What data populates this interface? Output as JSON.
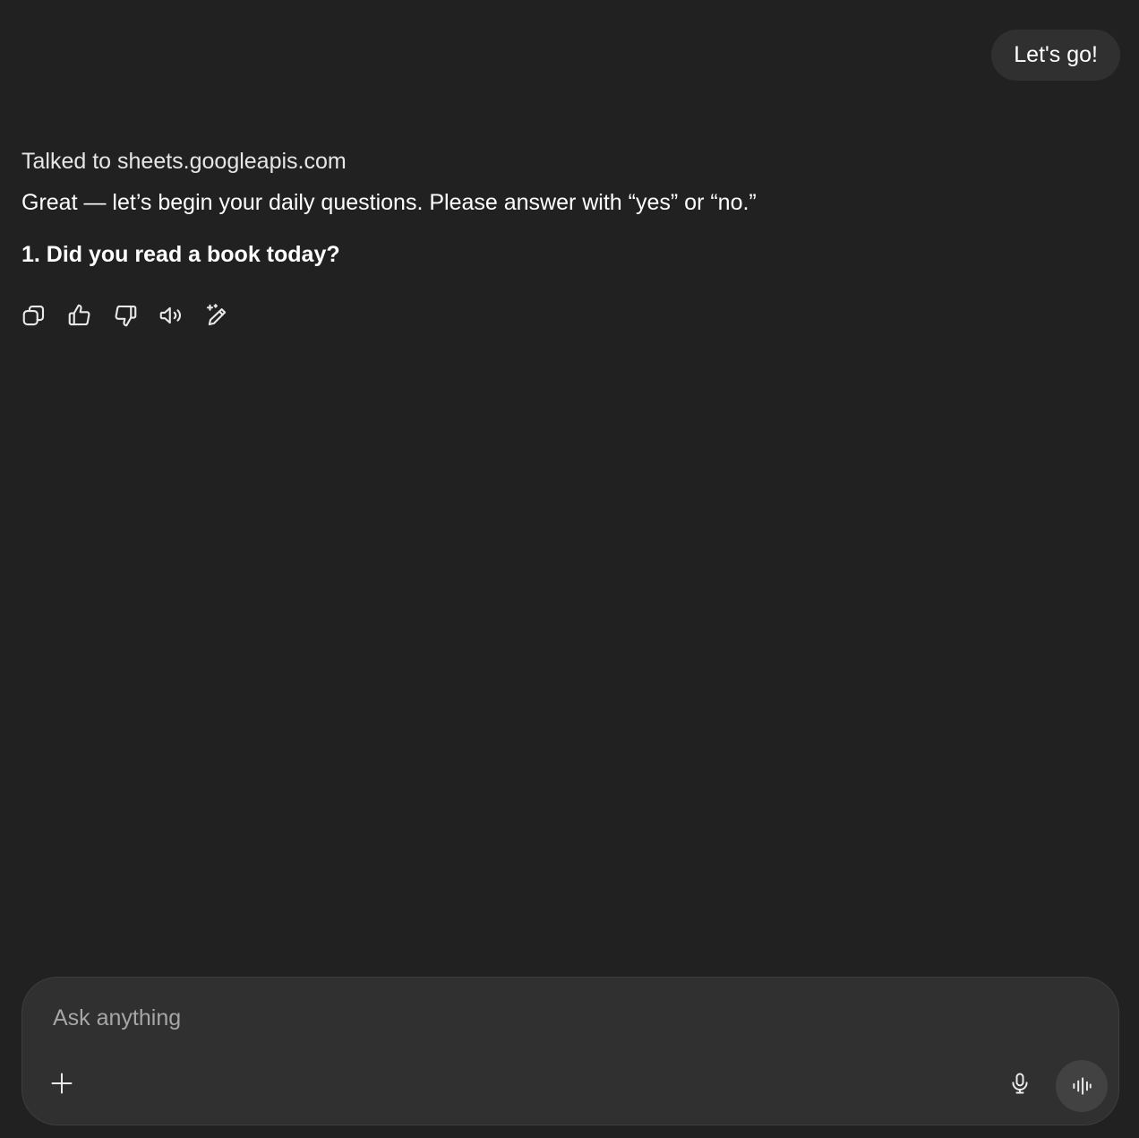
{
  "conversation": {
    "user_message": "Let's go!",
    "assistant": {
      "tool_status": "Talked to sheets.googleapis.com",
      "message": "Great — let’s begin your daily questions. Please answer with “yes” or “no.”",
      "question": "1. Did you read a book today?"
    },
    "actions": [
      {
        "name": "copy",
        "icon": "copy-icon"
      },
      {
        "name": "good-response",
        "icon": "thumbs-up-icon"
      },
      {
        "name": "bad-response",
        "icon": "thumbs-down-icon"
      },
      {
        "name": "read-aloud",
        "icon": "speaker-icon"
      },
      {
        "name": "edit-canvas",
        "icon": "sparkle-pencil-icon"
      }
    ]
  },
  "composer": {
    "placeholder": "Ask anything",
    "value": "",
    "add_icon": "plus-icon",
    "mic_icon": "microphone-icon",
    "voice_icon": "voice-waveform-icon"
  }
}
